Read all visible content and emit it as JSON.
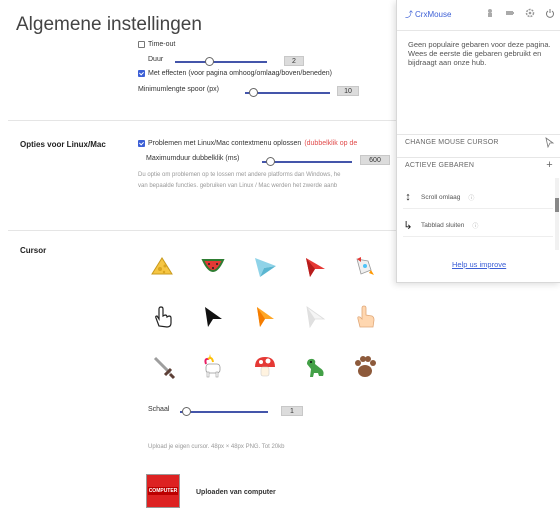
{
  "page": {
    "title": "Algemene instellingen"
  },
  "general": {
    "timeout_label": "Time-out",
    "duration_label": "Duur",
    "duration_value": "2",
    "effects_label": "Met effecten (voor pagina omhoog/omlaag/boven/beneden)",
    "min_length_label": "Minimumlengte spoor (px)",
    "min_length_value": "10"
  },
  "linux": {
    "section_label": "Opties voor Linux/Mac",
    "checkbox_label": "Problemen met Linux/Mac contextmenu oplossen",
    "warning": "(dubbelklik op de",
    "max_dblclick_label": "Maximumduur dubbelklik (ms)",
    "max_dblclick_value": "600",
    "help_line1": "Du optie om problemen op te lossen met andere platforms dan Windows, he",
    "help_line2": "van bepaalde functies. gebruiken van Linux / Mac werden het zwerde aanb"
  },
  "cursor": {
    "section_label": "Cursor",
    "scale_label": "Schaal",
    "scale_value": "1",
    "upload_note": "Upload je eigen cursor. 48px × 48px PNG. Tot 20kb",
    "upload_logo_text": "COMPUTER",
    "upload_label": "Uploaden van computer",
    "icons": [
      "cheese-cursor-icon",
      "watermelon-cursor-icon",
      "paper-plane-cursor-icon",
      "red-arrow-cursor-icon",
      "rocket-cursor-icon",
      "hand-outline-cursor-icon",
      "black-arrow-cursor-icon",
      "orange-arrow-cursor-icon",
      "white-arrow-cursor-icon",
      "pointing-hand-cursor-icon",
      "sword-cursor-icon",
      "unicorn-cursor-icon",
      "mushroom-cursor-icon",
      "dinosaur-cursor-icon",
      "paw-cursor-icon"
    ]
  },
  "popup": {
    "brand": "CrxMouse",
    "message": "Geen populaire gebaren voor deze pagina. Wees de eerste die gebaren gebruikt en bijdraagt aan onze hub.",
    "change_cursor_label": "CHANGE MOUSE CURSOR",
    "active_gestures_label": "ACTIEVE GEBAREN",
    "add_symbol": "+",
    "gestures": [
      {
        "icon": "↕",
        "label": "Scroll omlaag",
        "info": "ⓘ"
      },
      {
        "icon": "↳",
        "label": "Tabblad sluiten",
        "info": "ⓘ"
      }
    ],
    "help_link": "Help us improve"
  }
}
